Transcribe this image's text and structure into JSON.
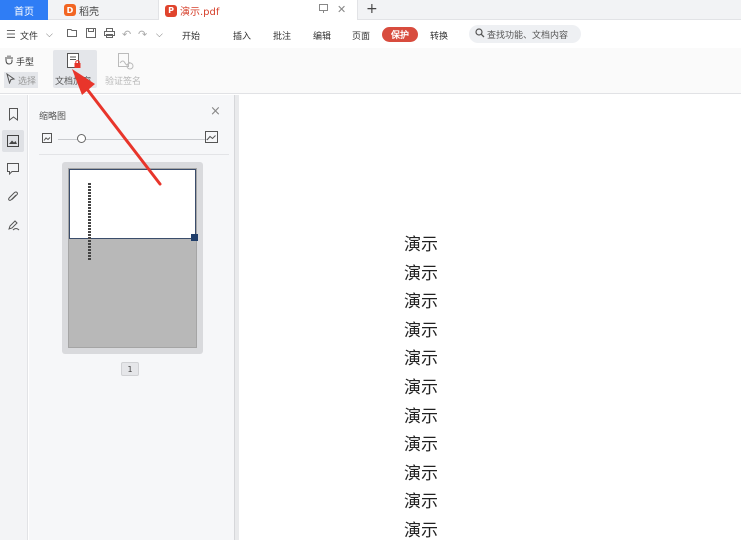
{
  "tabs": {
    "home": "首页",
    "daoke": "稻壳",
    "doc": "演示.pdf"
  },
  "menu": {
    "file": "文件",
    "items": [
      "开始",
      "插入",
      "批注",
      "编辑",
      "页面"
    ],
    "protect": "保护",
    "convert": "转换",
    "search_placeholder": "查找功能、文档内容"
  },
  "ribbon": {
    "hand": "手型",
    "select": "选择",
    "encrypt": "文档加密",
    "sign": "验证签名"
  },
  "thumbnail_panel": {
    "title": "缩略图",
    "zoom_level": 0.15,
    "page_number": "1"
  },
  "document": {
    "lines": [
      "演示",
      "演示",
      "演示",
      "演示",
      "演示",
      "演示",
      "演示",
      "演示",
      "演示",
      "演示",
      "演示"
    ]
  },
  "colors": {
    "accent": "#2f7df5",
    "protect": "#d84c3e",
    "arrow": "#e8352b"
  },
  "icons": {
    "menu": "hamburger-icon",
    "open": "folder-open-icon",
    "save": "save-icon",
    "print": "print-icon",
    "undo": "undo-icon",
    "redo": "redo-icon",
    "more": "dropdown-icon",
    "search": "search-icon",
    "hand": "hand-icon",
    "select": "cursor-icon",
    "encrypt": "document-lock-icon",
    "sign": "signature-icon"
  }
}
